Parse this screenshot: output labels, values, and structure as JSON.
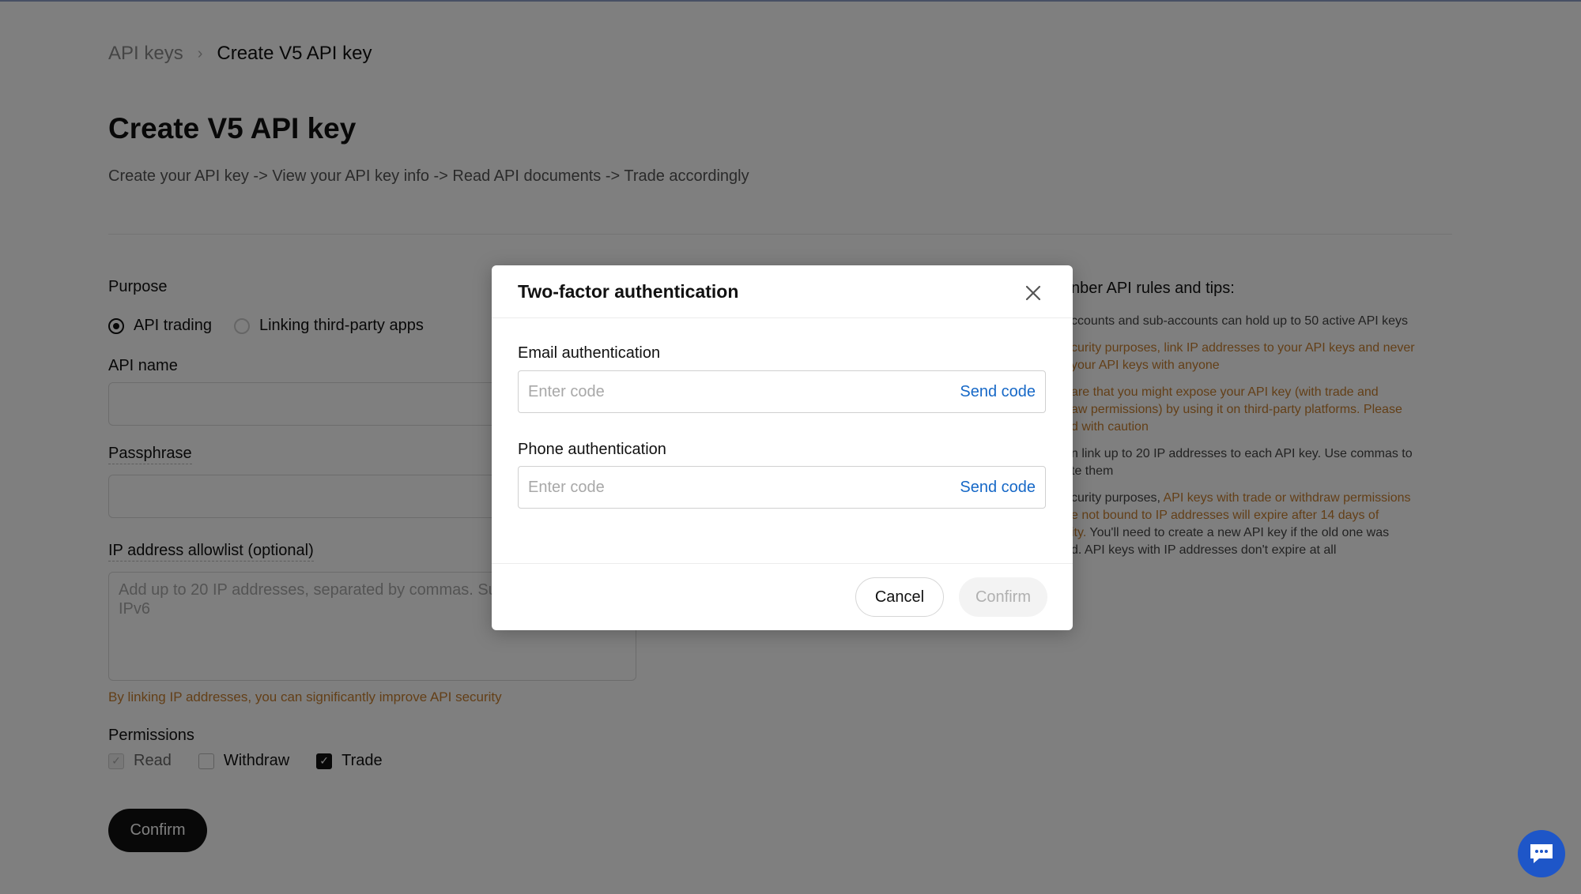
{
  "breadcrumb": {
    "parent": "API keys",
    "separator": "›",
    "current": "Create V5 API key"
  },
  "page": {
    "title": "Create V5 API key",
    "subtitle": "Create your API key -> View your API key info -> Read API documents -> Trade accordingly"
  },
  "form": {
    "purpose_label": "Purpose",
    "purpose_options": [
      "API trading",
      "Linking third-party apps"
    ],
    "purpose_selected": "API trading",
    "api_name_label": "API name",
    "passphrase_label": "Passphrase",
    "ip_label": "IP address allowlist (optional)",
    "ip_placeholder": "Add up to 20 IP addresses, separated by commas. Su",
    "ip_placeholder_line2": "IPv6",
    "ip_warning": "By linking IP addresses, you can significantly improve API security",
    "permissions_label": "Permissions",
    "permissions": [
      {
        "label": "Read",
        "state": "checked-disabled"
      },
      {
        "label": "Withdraw",
        "state": "unchecked"
      },
      {
        "label": "Trade",
        "state": "checked"
      }
    ],
    "confirm_label": "Confirm"
  },
  "tips": {
    "title": "nber API rules and tips:",
    "items": [
      {
        "lines": [
          "ccounts and sub-accounts can hold up to 50 active API keys"
        ],
        "color": "gray"
      },
      {
        "lines": [
          "curity purposes, link IP addresses to your API keys and never",
          "your API keys with anyone"
        ],
        "color": "orange"
      },
      {
        "lines": [
          "are that you might expose your API key (with trade and",
          "aw permissions) by using it on third-party platforms. Please",
          "d with caution"
        ],
        "color": "orange"
      },
      {
        "lines": [
          "n link up to 20 IP addresses to each API key. Use commas to",
          "te them"
        ],
        "color": "gray"
      }
    ],
    "mixed": {
      "l1_gray": "curity purposes, ",
      "l1_orange": "API keys with trade or withdraw permissions",
      "l2_orange": "e not bound to IP addresses will expire after 14 days of",
      "l3_orange": "ity.",
      "l3_gray": " You'll need to create a new API key if the old one was",
      "l4_gray": "d. API keys with IP addresses don't expire at all"
    }
  },
  "modal": {
    "title": "Two-factor authentication",
    "close_icon": "close-icon",
    "email_label": "Email authentication",
    "email_placeholder": "Enter code",
    "email_send": "Send code",
    "phone_label": "Phone authentication",
    "phone_placeholder": "Enter code",
    "phone_send": "Send code",
    "cancel_label": "Cancel",
    "confirm_label": "Confirm"
  },
  "colors": {
    "accent_link": "#1668c7",
    "warning": "#c77e2f",
    "primary_button": "#111111",
    "chat_button": "#1e56c8"
  },
  "icons": {
    "chat": "chat-bubble-icon"
  }
}
